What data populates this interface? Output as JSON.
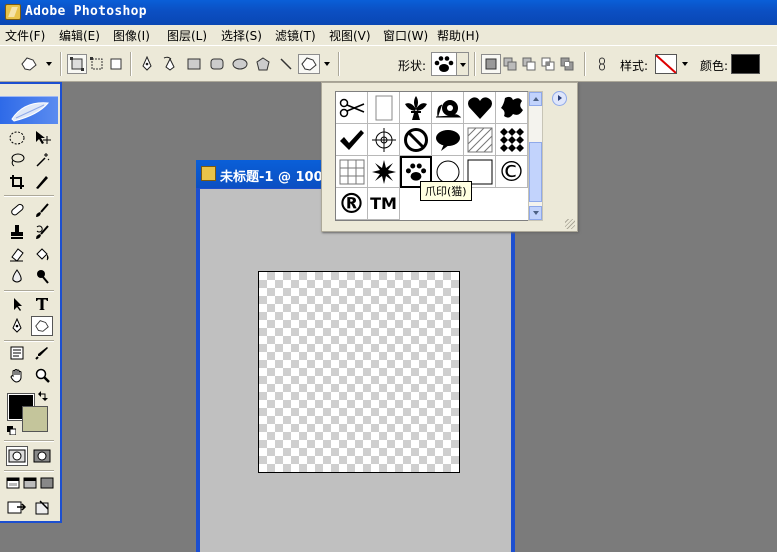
{
  "app": {
    "title": "Adobe Photoshop"
  },
  "menu": [
    "文件(F)",
    "编辑(E)",
    "图像(I)",
    "图层(L)",
    "选择(S)",
    "滤镜(T)",
    "视图(V)",
    "窗口(W)",
    "帮助(H)"
  ],
  "options": {
    "shape_label": "形状:",
    "style_label": "样式:",
    "color_label": "颜色:",
    "color_value": "#000000"
  },
  "document": {
    "title": "未标题-1 @ 100%"
  },
  "shape_picker": {
    "shapes": [
      "scissors-shape",
      "page-shape",
      "fleur-de-lis-shape",
      "snail-shape",
      "heart-shape",
      "blob-shape",
      "checkmark-shape",
      "target-shape",
      "no-sign-shape",
      "speech-bubble-shape",
      "hatch-pattern-shape",
      "diamond-grid-shape",
      "grid-shape",
      "starburst-shape",
      "paw-print-shape",
      "circle-shape",
      "square-shape",
      "copyright-shape",
      "registered-shape",
      "trademark-shape"
    ],
    "selected": "paw-print-shape",
    "glyphs": {
      "copyright": "©",
      "registered": "®",
      "trademark": "TM"
    },
    "tooltip": "爪印(猫)"
  },
  "colors": {
    "foreground": "#000000",
    "background": "#c4c59b",
    "titlebar": "#0b4fc2",
    "panel": "#ece9d8"
  }
}
